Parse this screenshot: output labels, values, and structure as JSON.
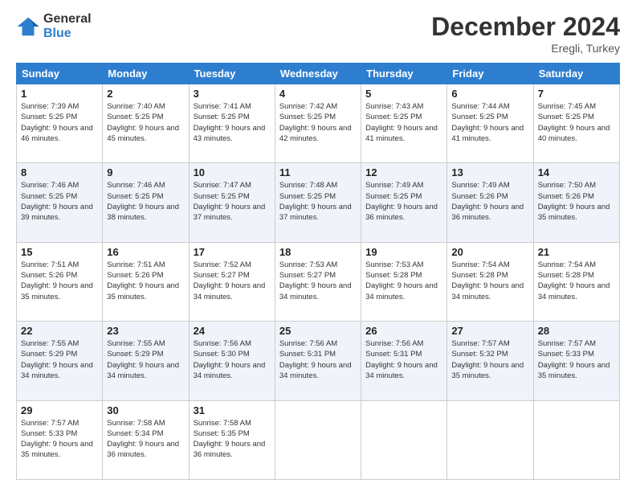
{
  "logo": {
    "general": "General",
    "blue": "Blue"
  },
  "title": "December 2024",
  "location": "Eregli, Turkey",
  "days_header": [
    "Sunday",
    "Monday",
    "Tuesday",
    "Wednesday",
    "Thursday",
    "Friday",
    "Saturday"
  ],
  "weeks": [
    [
      {
        "day": "1",
        "sunrise": "7:39 AM",
        "sunset": "5:25 PM",
        "daylight": "9 hours and 46 minutes."
      },
      {
        "day": "2",
        "sunrise": "7:40 AM",
        "sunset": "5:25 PM",
        "daylight": "9 hours and 45 minutes."
      },
      {
        "day": "3",
        "sunrise": "7:41 AM",
        "sunset": "5:25 PM",
        "daylight": "9 hours and 43 minutes."
      },
      {
        "day": "4",
        "sunrise": "7:42 AM",
        "sunset": "5:25 PM",
        "daylight": "9 hours and 42 minutes."
      },
      {
        "day": "5",
        "sunrise": "7:43 AM",
        "sunset": "5:25 PM",
        "daylight": "9 hours and 41 minutes."
      },
      {
        "day": "6",
        "sunrise": "7:44 AM",
        "sunset": "5:25 PM",
        "daylight": "9 hours and 41 minutes."
      },
      {
        "day": "7",
        "sunrise": "7:45 AM",
        "sunset": "5:25 PM",
        "daylight": "9 hours and 40 minutes."
      }
    ],
    [
      {
        "day": "8",
        "sunrise": "7:46 AM",
        "sunset": "5:25 PM",
        "daylight": "9 hours and 39 minutes."
      },
      {
        "day": "9",
        "sunrise": "7:46 AM",
        "sunset": "5:25 PM",
        "daylight": "9 hours and 38 minutes."
      },
      {
        "day": "10",
        "sunrise": "7:47 AM",
        "sunset": "5:25 PM",
        "daylight": "9 hours and 37 minutes."
      },
      {
        "day": "11",
        "sunrise": "7:48 AM",
        "sunset": "5:25 PM",
        "daylight": "9 hours and 37 minutes."
      },
      {
        "day": "12",
        "sunrise": "7:49 AM",
        "sunset": "5:25 PM",
        "daylight": "9 hours and 36 minutes."
      },
      {
        "day": "13",
        "sunrise": "7:49 AM",
        "sunset": "5:26 PM",
        "daylight": "9 hours and 36 minutes."
      },
      {
        "day": "14",
        "sunrise": "7:50 AM",
        "sunset": "5:26 PM",
        "daylight": "9 hours and 35 minutes."
      }
    ],
    [
      {
        "day": "15",
        "sunrise": "7:51 AM",
        "sunset": "5:26 PM",
        "daylight": "9 hours and 35 minutes."
      },
      {
        "day": "16",
        "sunrise": "7:51 AM",
        "sunset": "5:26 PM",
        "daylight": "9 hours and 35 minutes."
      },
      {
        "day": "17",
        "sunrise": "7:52 AM",
        "sunset": "5:27 PM",
        "daylight": "9 hours and 34 minutes."
      },
      {
        "day": "18",
        "sunrise": "7:53 AM",
        "sunset": "5:27 PM",
        "daylight": "9 hours and 34 minutes."
      },
      {
        "day": "19",
        "sunrise": "7:53 AM",
        "sunset": "5:28 PM",
        "daylight": "9 hours and 34 minutes."
      },
      {
        "day": "20",
        "sunrise": "7:54 AM",
        "sunset": "5:28 PM",
        "daylight": "9 hours and 34 minutes."
      },
      {
        "day": "21",
        "sunrise": "7:54 AM",
        "sunset": "5:28 PM",
        "daylight": "9 hours and 34 minutes."
      }
    ],
    [
      {
        "day": "22",
        "sunrise": "7:55 AM",
        "sunset": "5:29 PM",
        "daylight": "9 hours and 34 minutes."
      },
      {
        "day": "23",
        "sunrise": "7:55 AM",
        "sunset": "5:29 PM",
        "daylight": "9 hours and 34 minutes."
      },
      {
        "day": "24",
        "sunrise": "7:56 AM",
        "sunset": "5:30 PM",
        "daylight": "9 hours and 34 minutes."
      },
      {
        "day": "25",
        "sunrise": "7:56 AM",
        "sunset": "5:31 PM",
        "daylight": "9 hours and 34 minutes."
      },
      {
        "day": "26",
        "sunrise": "7:56 AM",
        "sunset": "5:31 PM",
        "daylight": "9 hours and 34 minutes."
      },
      {
        "day": "27",
        "sunrise": "7:57 AM",
        "sunset": "5:32 PM",
        "daylight": "9 hours and 35 minutes."
      },
      {
        "day": "28",
        "sunrise": "7:57 AM",
        "sunset": "5:33 PM",
        "daylight": "9 hours and 35 minutes."
      }
    ],
    [
      {
        "day": "29",
        "sunrise": "7:57 AM",
        "sunset": "5:33 PM",
        "daylight": "9 hours and 35 minutes."
      },
      {
        "day": "30",
        "sunrise": "7:58 AM",
        "sunset": "5:34 PM",
        "daylight": "9 hours and 36 minutes."
      },
      {
        "day": "31",
        "sunrise": "7:58 AM",
        "sunset": "5:35 PM",
        "daylight": "9 hours and 36 minutes."
      },
      null,
      null,
      null,
      null
    ]
  ]
}
